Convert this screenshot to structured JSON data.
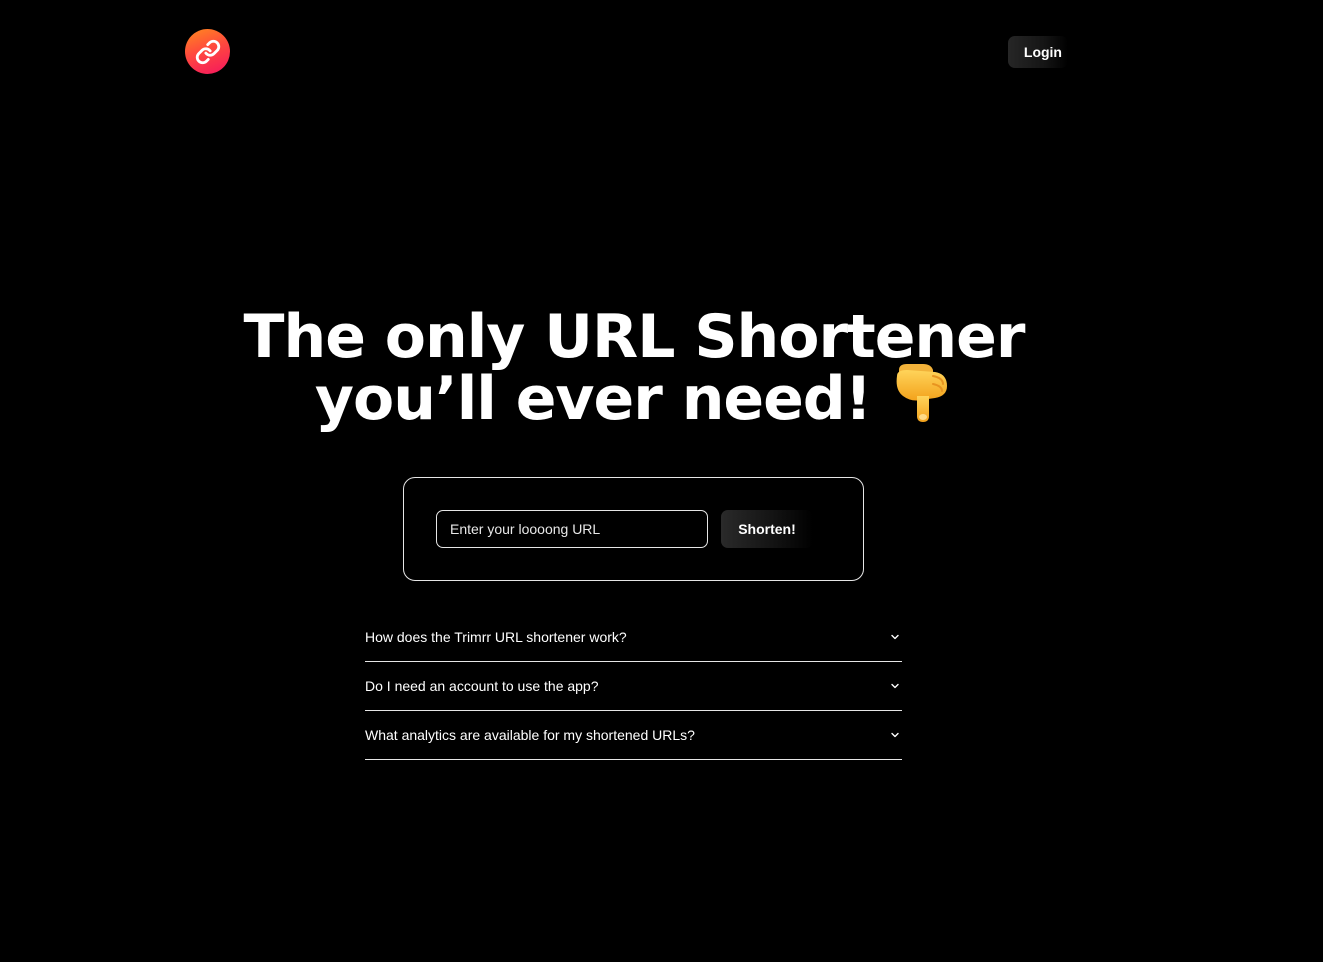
{
  "header": {
    "logo_icon": "link-icon",
    "logo_gradient": [
      "#ff8a1e",
      "#ff4a3d",
      "#f5155f"
    ],
    "login_label": "Login"
  },
  "hero": {
    "line1": "The only URL Shortener",
    "line2": "you’ll ever need!",
    "hand_icon": "pointing-down-hand-icon"
  },
  "form": {
    "placeholder": "Enter your loooong URL",
    "value": "",
    "submit_label": "Shorten!"
  },
  "faq": {
    "items": [
      {
        "question": "How does the Trimrr URL shortener work?",
        "icon": "chevron-down-icon"
      },
      {
        "question": "Do I need an account to use the app?",
        "icon": "chevron-down-icon"
      },
      {
        "question": "What analytics are available for my shortened URLs?",
        "icon": "chevron-down-icon"
      }
    ]
  },
  "colors": {
    "background": "#000000",
    "text": "#ffffff",
    "border": "#e6e6e6"
  }
}
